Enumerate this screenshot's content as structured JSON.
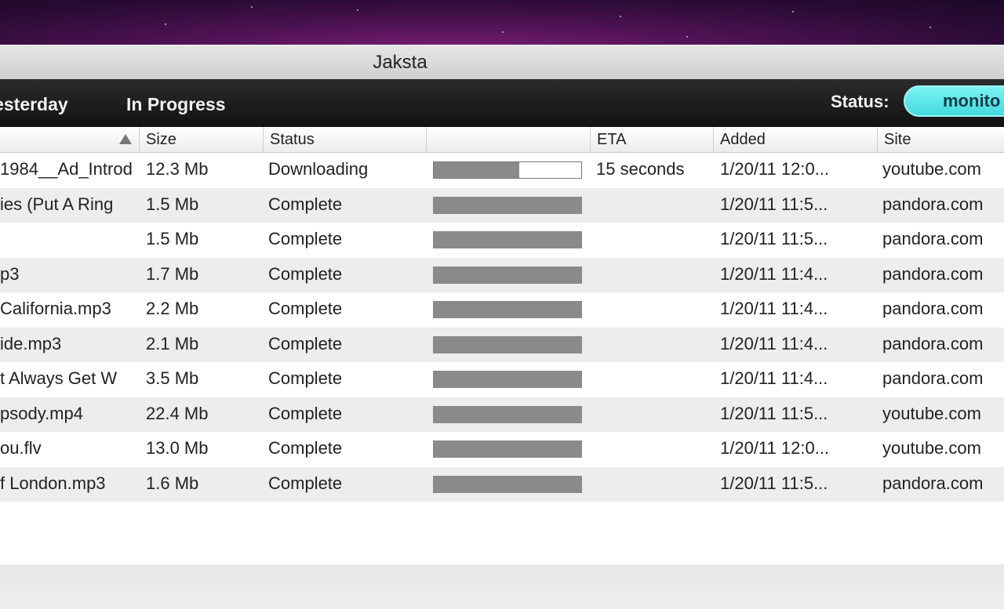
{
  "window": {
    "title": "Jaksta"
  },
  "toolbar": {
    "tabs": [
      "Yesterday",
      "In Progress"
    ],
    "status_label": "Status:",
    "status_value": "monito"
  },
  "columns": {
    "name": "",
    "size": "Size",
    "status": "Status",
    "progress": "",
    "eta": "ETA",
    "added": "Added",
    "site": "Site"
  },
  "rows": [
    {
      "name": "1984__Ad_Introd",
      "size": "12.3 Mb",
      "status": "Downloading",
      "progress": 0.58,
      "eta": "15 seconds",
      "added": "1/20/11 12:0...",
      "site": "youtube.com"
    },
    {
      "name": "ies (Put A Ring",
      "size": "1.5 Mb",
      "status": "Complete",
      "progress": 1,
      "eta": "",
      "added": "1/20/11 11:5...",
      "site": "pandora.com"
    },
    {
      "name": "",
      "size": "1.5 Mb",
      "status": "Complete",
      "progress": 1,
      "eta": "",
      "added": "1/20/11 11:5...",
      "site": "pandora.com"
    },
    {
      "name": "p3",
      "size": "1.7 Mb",
      "status": "Complete",
      "progress": 1,
      "eta": "",
      "added": "1/20/11 11:4...",
      "site": "pandora.com"
    },
    {
      "name": "California.mp3",
      "size": "2.2 Mb",
      "status": "Complete",
      "progress": 1,
      "eta": "",
      "added": "1/20/11 11:4...",
      "site": "pandora.com"
    },
    {
      "name": "ide.mp3",
      "size": "2.1 Mb",
      "status": "Complete",
      "progress": 1,
      "eta": "",
      "added": "1/20/11 11:4...",
      "site": "pandora.com"
    },
    {
      "name": "t Always Get W",
      "size": "3.5 Mb",
      "status": "Complete",
      "progress": 1,
      "eta": "",
      "added": "1/20/11 11:4...",
      "site": "pandora.com"
    },
    {
      "name": "psody.mp4",
      "size": "22.4 Mb",
      "status": "Complete",
      "progress": 1,
      "eta": "",
      "added": "1/20/11 11:5...",
      "site": "youtube.com"
    },
    {
      "name": "ou.flv",
      "size": "13.0 Mb",
      "status": "Complete",
      "progress": 1,
      "eta": "",
      "added": "1/20/11 12:0...",
      "site": "youtube.com"
    },
    {
      "name": "f London.mp3",
      "size": "1.6 Mb",
      "status": "Complete",
      "progress": 1,
      "eta": "",
      "added": "1/20/11 11:5...",
      "site": "pandora.com"
    }
  ],
  "colors": {
    "toolbar_bg": "#1a1a1a",
    "status_pill": "#4fe0e2",
    "progress_fill": "#8a8a8a",
    "row_alt": "#ededed"
  }
}
